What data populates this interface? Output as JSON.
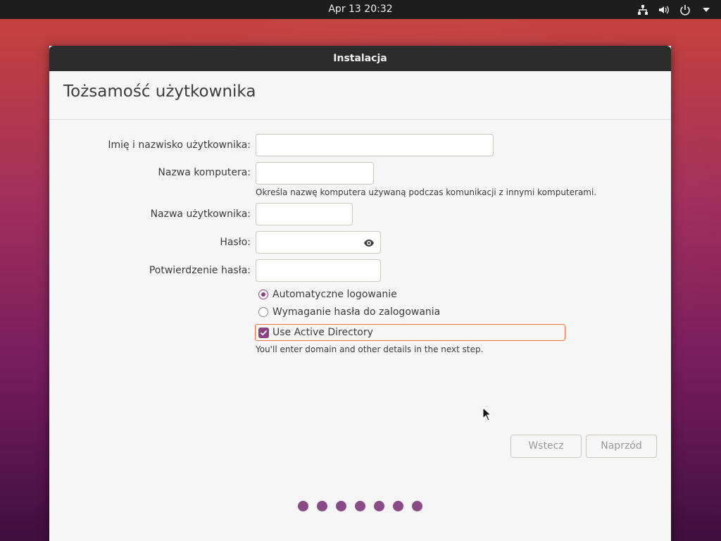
{
  "topbar": {
    "clock": "Apr 13  20:32",
    "icons": [
      "network-icon",
      "volume-icon",
      "power-icon",
      "menu-arrow-icon"
    ]
  },
  "window": {
    "title": "Instalacja",
    "page_title": "Tożsamość użytkownika"
  },
  "form": {
    "full_name_label": "Imię i nazwisko użytkownika:",
    "full_name_value": "",
    "computer_name_label": "Nazwa komputera:",
    "computer_name_value": "",
    "computer_name_hint": "Określa nazwę komputera używaną podczas komunikacji z innymi komputerami.",
    "username_label": "Nazwa użytkownika:",
    "username_value": "",
    "password_label": "Hasło:",
    "password_value": "",
    "confirm_label": "Potwierdzenie hasła:",
    "confirm_value": "",
    "auto_login_label": "Automatyczne logowanie",
    "auto_login_selected": true,
    "require_password_label": "Wymaganie hasła do zalogowania",
    "require_password_selected": false,
    "active_directory_label": "Use Active Directory",
    "active_directory_checked": true,
    "active_directory_hint": "You'll enter domain and other details in the next step."
  },
  "buttons": {
    "back": "Wstecz",
    "forward": "Naprzód"
  },
  "progress": {
    "total_steps": 7
  },
  "colors": {
    "accent": "#8a4183",
    "focus": "#e9703a"
  }
}
